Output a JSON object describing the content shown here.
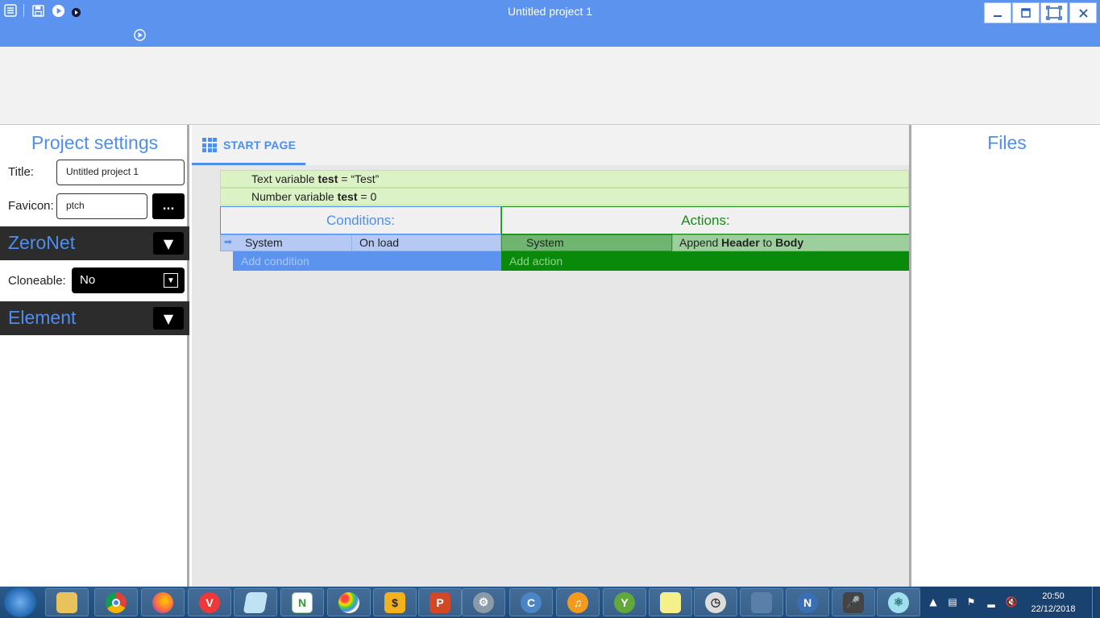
{
  "titlebar": {
    "title": "Untitled project 1",
    "minimize_label": "▁",
    "maximize_label": "☐",
    "fullscreen_label": "⛶",
    "close_label": "✕"
  },
  "left_panel": {
    "heading": "Project settings",
    "title_label": "Title:",
    "title_value": "Untitled project 1",
    "favicon_label": "Favicon:",
    "favicon_value": "ptch",
    "browse_label": "...",
    "zeronet_heading": "ZeroNet",
    "cloneable_label": "Cloneable:",
    "cloneable_value": "No",
    "element_heading": "Element",
    "expand_glyph": "▼"
  },
  "tab": {
    "label": "START PAGE"
  },
  "event_sheet": {
    "var1_prefix": "Text variable ",
    "var1_name": "test",
    "var1_suffix": " = “Test”",
    "var2_prefix": "Number variable ",
    "var2_name": "test",
    "var2_suffix": " = 0",
    "conditions_heading": "Conditions:",
    "actions_heading": "Actions:",
    "condition_object": "System",
    "condition_trigger": "On load",
    "action_object": "System",
    "action_prefix": "Append ",
    "action_target": "Header",
    "action_middle": " to ",
    "action_dest": "Body",
    "add_condition": "Add condition",
    "add_action": "Add action"
  },
  "right_panel": {
    "heading": "Files"
  },
  "taskbar": {
    "time": "20:50",
    "date": "22/12/2018",
    "apps": [
      "file-explorer",
      "chrome",
      "firefox",
      "vivaldi",
      "notepad",
      "notepad-plus-plus",
      "paint",
      "filmora",
      "powerpoint",
      "settings",
      "ccleaner",
      "audacity",
      "keepass",
      "sticky-notes",
      "stopwatch",
      "virtualbox",
      "netbeans",
      "microphone",
      "electron"
    ]
  },
  "colors": {
    "accent": "#4d8ef0",
    "titlebar": "#5b93ee",
    "action_green": "#0a8a0a",
    "variable_bg": "#daf2c4"
  }
}
